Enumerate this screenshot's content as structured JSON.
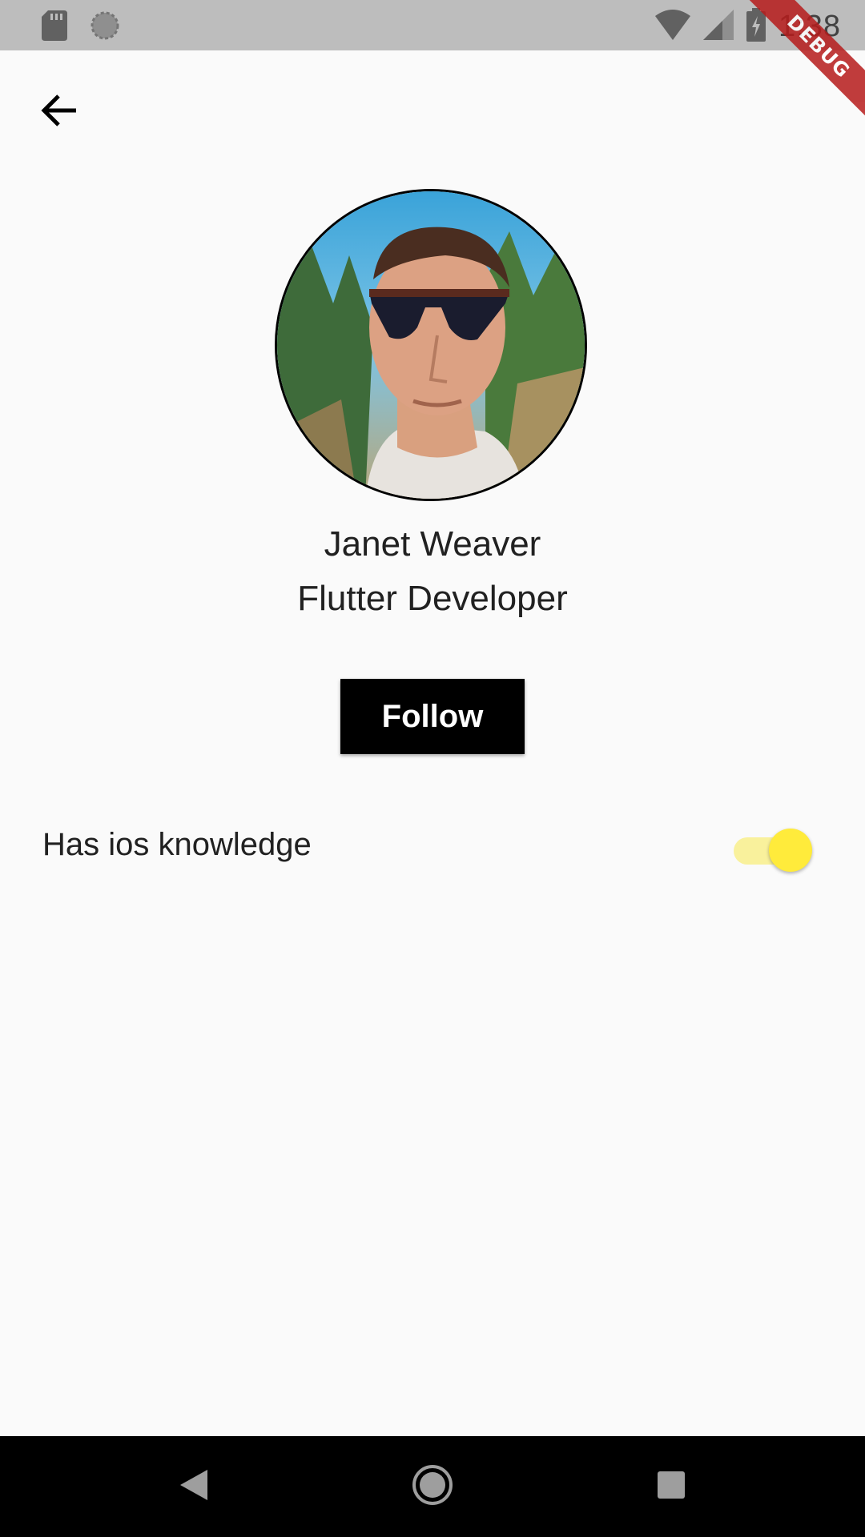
{
  "status_bar": {
    "time": "1:38",
    "icons": [
      "sd-card-icon",
      "sync-icon",
      "wifi-icon",
      "signal-icon",
      "battery-icon"
    ]
  },
  "debug_banner": {
    "label": "DEBUG"
  },
  "app_bar": {
    "back_icon": "arrow-back-icon"
  },
  "profile": {
    "name": "Janet Weaver",
    "role": "Flutter Developer",
    "follow_label": "Follow"
  },
  "settings": {
    "ios_knowledge": {
      "label": "Has ios knowledge",
      "enabled": true
    }
  },
  "nav_bar": {
    "icons": [
      "back-triangle-icon",
      "home-circle-icon",
      "recents-square-icon"
    ]
  },
  "colors": {
    "accent": "#ffeb3b",
    "accent_track": "#f9f19c",
    "button_bg": "#000000",
    "background": "#fafafa",
    "status_bar": "#bdbdbd"
  }
}
